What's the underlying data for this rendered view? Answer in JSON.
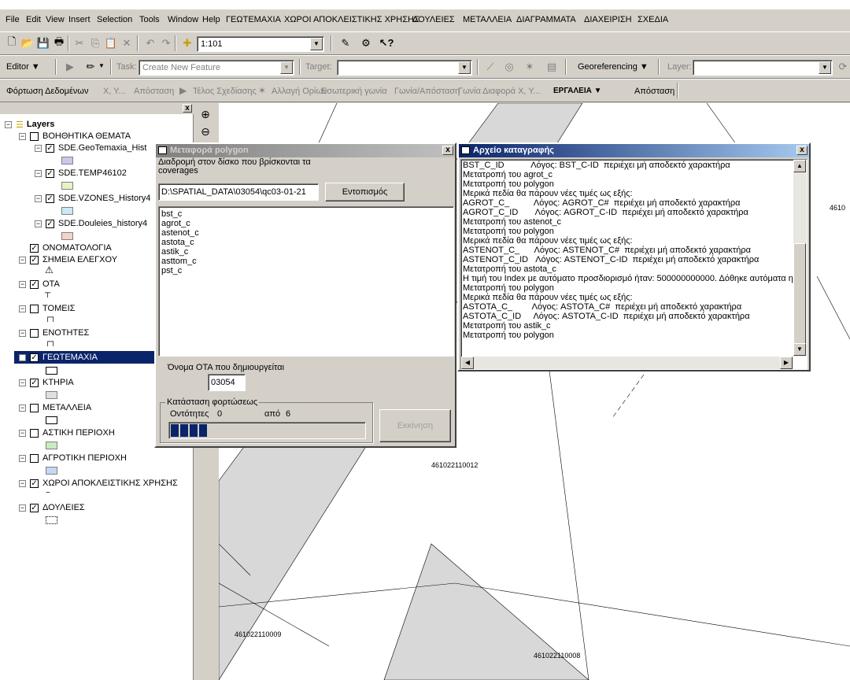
{
  "menu": [
    "File",
    "Edit",
    "View",
    "Insert",
    "Selection",
    "Tools",
    "Window",
    "Help",
    "ΓΕΩΤΕΜΑΧΙΑ",
    "ΧΩΡΟΙ ΑΠΟΚΛΕΙΣΤΙΚΗΣ ΧΡΗΣΗΣ",
    "ΔΟΥΛΕΙΕΣ",
    "ΜΕΤΑΛΛΕΙΑ",
    "ΔΙΑΓΡΑΜΜΑΤΑ",
    "ΔΙΑΧΕΙΡΙΣΗ",
    "ΣΧΕΔΙΑ"
  ],
  "standard_toolbar": {
    "scale": "1:101"
  },
  "editor_toolbar": {
    "editor_label": "Editor ▼",
    "task_label": "Task:",
    "task_value": "Create New Feature",
    "target_label": "Target:",
    "target_value": "",
    "georef_label": "Georeferencing ▼",
    "layer_label": "Layer:",
    "layer_value": ""
  },
  "custom_toolbar": {
    "load_data": "Φόρτωση Δεδομένων",
    "xy": "X, Y...",
    "distance": "Απόσταση",
    "end_drawing": "Τέλος Σχεδίασης",
    "change_bounds": "Αλλαγή Ορίων",
    "inner_angle": "Εσωτερική γωνία",
    "angle_distance": "Γωνία/Απόσταση",
    "angle": "Γωνία",
    "diff_xy": "Διαφορά X, Y...",
    "tools_menu": "ΕΡΓΑΛΕΙΑ ▼",
    "distance2": "Απόσταση"
  },
  "toc": {
    "root": "Layers",
    "items": [
      {
        "label": "ΒΟΗΘΗΤΙΚΑ ΘΕΜΑΤΑ",
        "checked": false,
        "level": 1
      },
      {
        "label": "SDE.GeoTemaxia_Hist",
        "checked": true,
        "level": 2
      },
      {
        "label": "SDE.TEMP46102",
        "checked": true,
        "level": 2
      },
      {
        "label": "SDE.VZONES_History4",
        "checked": true,
        "level": 2
      },
      {
        "label": "SDE.Douleies_history4",
        "checked": true,
        "level": 2
      },
      {
        "label": "ΟΝΟΜΑΤΟΛΟΓΙΑ",
        "checked": true,
        "level": 1
      },
      {
        "label": "ΣΗΜΕΙΑ ΕΛΕΓΧΟΥ",
        "checked": true,
        "level": 1
      },
      {
        "label": "ΟΤΑ",
        "checked": true,
        "level": 1
      },
      {
        "label": "ΤΟΜΕΙΣ",
        "checked": false,
        "level": 1
      },
      {
        "label": "ΕΝΟΤΗΤΕΣ",
        "checked": false,
        "level": 1
      },
      {
        "label": "ΓΕΩΤΕΜΑΧΙΑ",
        "checked": true,
        "level": 1
      },
      {
        "label": "ΚΤΗΡΙΑ",
        "checked": true,
        "level": 1
      },
      {
        "label": "ΜΕΤΑΛΛΕΙΑ",
        "checked": false,
        "level": 1
      },
      {
        "label": "ΑΣΤΙΚΗ ΠΕΡΙΟΧΗ",
        "checked": false,
        "level": 1
      },
      {
        "label": "ΑΓΡΟΤΙΚΗ ΠΕΡΙΟΧΗ",
        "checked": false,
        "level": 1
      },
      {
        "label": "ΧΩΡΟΙ ΑΠΟΚΛΕΙΣΤΙΚΗΣ ΧΡΗΣΗΣ",
        "checked": true,
        "level": 1
      },
      {
        "label": "ΔΟΥΛΕΙΕΣ",
        "checked": true,
        "level": 1
      }
    ]
  },
  "map": {
    "labels": [
      "4610",
      "461022110012",
      "461022110009",
      "461022110008"
    ]
  },
  "polygon_dialog": {
    "title": "Μεταφορά polygon",
    "path_label": "Διαδρομή στον δίσκο που βρίσκονται τα coverages",
    "path_value": "D:\\SPATIAL_DATA\\03054\\qc03-01-21",
    "locate_button": "Εντοπισμός",
    "coverages": [
      "bst_c",
      "agrot_c",
      "astenot_c",
      "astota_c",
      "astik_c",
      "asttom_c",
      "pst_c"
    ],
    "ota_label": "Όνομα ΟΤΑ που δημιουργείται",
    "ota_value": "03054",
    "status_group": "Κατάσταση φορτώσεως",
    "entities_label": "Οντότητες",
    "entities_value": "0",
    "of_label": "από",
    "of_value": "6",
    "progress": 0.18,
    "start_button": "Εκκίνηση"
  },
  "log_dialog": {
    "title": "Αρχείο καταγραφής",
    "lines": [
      "BST_C_ID           Λόγος: BST_C-ID  περιέχει μή αποδεκτό χαρακτήρα",
      "Μετατροπή του agrot_c",
      "Μετατροπή του polygon",
      "Μερικά πεδία θα πάρουν νέες τιμές ως εξής:",
      "AGROT_C_          Λόγος: AGROT_C#  περιέχει μή αποδεκτό χαρακτήρα",
      "AGROT_C_ID       Λόγος: AGROT_C-ID  περιέχει μή αποδεκτό χαρακτήρα",
      "Μετατροπή του astenot_c",
      "Μετατροπή του polygon",
      "Μερικά πεδία θα πάρουν νέες τιμές ως εξής:",
      "ASTENOT_C_      Λόγος: ASTENOT_C#  περιέχει μή αποδεκτό χαρακτήρα",
      "ASTENOT_C_ID   Λόγος: ASTENOT_C-ID  περιέχει μή αποδεκτό χαρακτήρα",
      "Μετατροπή του astota_c",
      "Η τιμή του Index με αυτόματο προσδιορισμό ήταν: 500000000000. Δόθηκε αυτόματα η",
      "Μετατροπή του polygon",
      "Μερικά πεδία θα πάρουν νέες τιμές ως εξής:",
      "ASTOTA_C_        Λόγος: ASTOTA_C#  περιέχει μή αποδεκτό χαρακτήρα",
      "ASTOTA_C_ID     Λόγος: ASTOTA_C-ID  περιέχει μή αποδεκτό χαρακτήρα",
      "Μετατροπή του astik_c",
      "Μετατροπή του polygon"
    ]
  }
}
